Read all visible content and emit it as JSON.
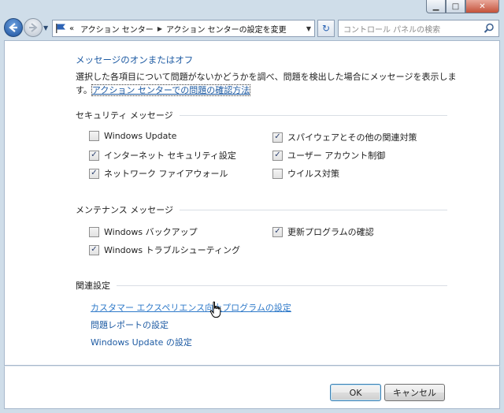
{
  "window": {
    "controls": {
      "minimize": "▁",
      "maximize": "□",
      "close": "✕"
    }
  },
  "nav": {
    "back_icon": "back-arrow-icon",
    "forward_icon": "forward-arrow-icon",
    "recent_pages_glyph": "▼",
    "breadcrumb_prefix": "«",
    "breadcrumb": [
      "アクション センター",
      "アクション センターの設定を変更"
    ],
    "breadcrumb_sep": "▶",
    "dropdown_glyph": "▼",
    "refresh_glyph": "↻",
    "search_placeholder": "コントロール パネルの検索"
  },
  "main": {
    "heading": "メッセージのオンまたはオフ",
    "description_text": "選択した各項目について問題がないかどうかを調べ、問題を検出した場合にメッセージを表示します。",
    "description_link": "アクション センターでの問題の確認方法",
    "security": {
      "title": "セキュリティ メッセージ",
      "left": [
        {
          "label": "Windows Update",
          "checked": false
        },
        {
          "label": "インターネット セキュリティ設定",
          "checked": true
        },
        {
          "label": "ネットワーク ファイアウォール",
          "checked": true
        }
      ],
      "right": [
        {
          "label": "スパイウェアとその他の関連対策",
          "checked": true
        },
        {
          "label": "ユーザー アカウント制御",
          "checked": true
        },
        {
          "label": "ウイルス対策",
          "checked": false
        }
      ]
    },
    "maintenance": {
      "title": "メンテナンス メッセージ",
      "left": [
        {
          "label": "Windows バックアップ",
          "checked": false
        },
        {
          "label": "Windows トラブルシューティング",
          "checked": true
        }
      ],
      "right": [
        {
          "label": "更新プログラムの確認",
          "checked": true
        }
      ]
    },
    "related": {
      "title": "関連設定",
      "links": [
        "カスタマー エクスペリエンス向上プログラムの設定",
        "問題レポートの設定",
        "Windows Update の設定"
      ]
    },
    "check_glyph": "✓"
  },
  "footer": {
    "ok_label": "OK",
    "cancel_label": "キャンセル"
  },
  "colors": {
    "link": "#1e5ba3",
    "frame": "#cfdde9"
  }
}
